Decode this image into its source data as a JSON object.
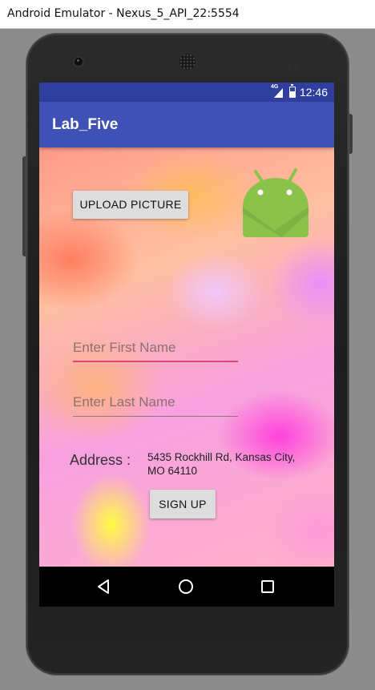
{
  "window": {
    "title": "Android Emulator - Nexus_5_API_22:5554"
  },
  "status_bar": {
    "network": "4G",
    "time": "12:46"
  },
  "app_bar": {
    "title": "Lab_Five"
  },
  "form": {
    "upload_button_label": "UPLOAD PICTURE",
    "first_name_placeholder": "Enter First Name",
    "last_name_placeholder": "Enter Last Name",
    "address_label": "Address :",
    "address_value_line1": "5435 Rockhill Rd, Kansas City,",
    "address_value_line2": "MO 64110",
    "signup_button_label": "SIGN UP"
  },
  "colors": {
    "status_bar": "#303f9f",
    "app_bar": "#3f51b5",
    "accent": "#e0467a",
    "android_green": "#8bc34a"
  },
  "icons": {
    "image_view": "android-robot-icon",
    "nav": [
      "back-icon",
      "home-icon",
      "recent-apps-icon"
    ]
  }
}
